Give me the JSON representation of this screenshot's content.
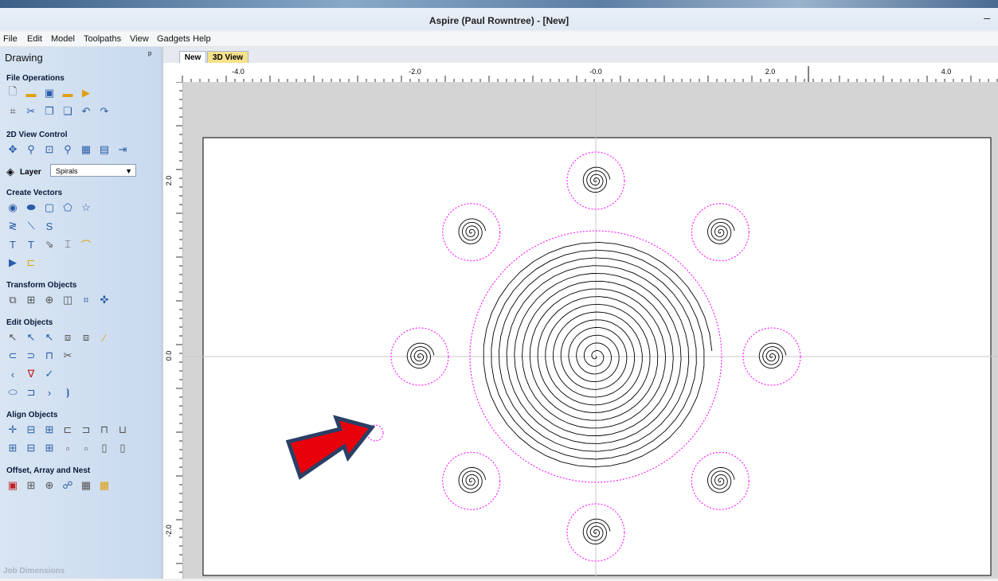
{
  "window": {
    "title": "Aspire (Paul Rowntree) - [New]",
    "minimize_glyph": "–"
  },
  "menu": [
    "File",
    "Edit",
    "Model",
    "Toolpaths",
    "View",
    "Gadgets",
    "Help"
  ],
  "sidebar": {
    "title": "Drawing",
    "pin_glyph": "ᵖ",
    "sections": {
      "file_operations": "File Operations",
      "view_control": "2D View Control",
      "create_vectors": "Create Vectors",
      "transform_objects": "Transform Objects",
      "edit_objects": "Edit Objects",
      "align_objects": "Align Objects",
      "offset_array_nest": "Offset, Array and Nest"
    },
    "layer": {
      "label": "Layer",
      "value": "Spirals"
    },
    "job_dimensions": "Job Dimensions"
  },
  "tabs": [
    {
      "label": "New",
      "active": true
    },
    {
      "label": "3D View",
      "active": false
    }
  ],
  "ruler": {
    "top_labels": [
      "-4.0",
      "-2.0",
      "-0.0",
      "2.0",
      "4.0"
    ],
    "left_labels": [
      "2.0",
      "0.0",
      "-2.0"
    ]
  },
  "colors": {
    "selection": "#ff00ff",
    "arrow": "#e8000b",
    "arrow_outline": "#2a3f66",
    "sidebar": "#d3e1f1"
  },
  "icons": [
    "new-file-icon",
    "open-folder-icon",
    "save-icon",
    "save-as-icon",
    "import-icon",
    "select-all-icon",
    "cut-icon",
    "copy-icon",
    "paste-icon",
    "undo-icon",
    "redo-icon",
    "pan-icon",
    "zoom-icon",
    "zoom-fit-icon",
    "zoom-box-icon",
    "layer-icon",
    "circle-icon",
    "ellipse-icon",
    "rectangle-icon",
    "polygon-icon",
    "star-icon",
    "text-icon",
    "arrow-icon"
  ]
}
